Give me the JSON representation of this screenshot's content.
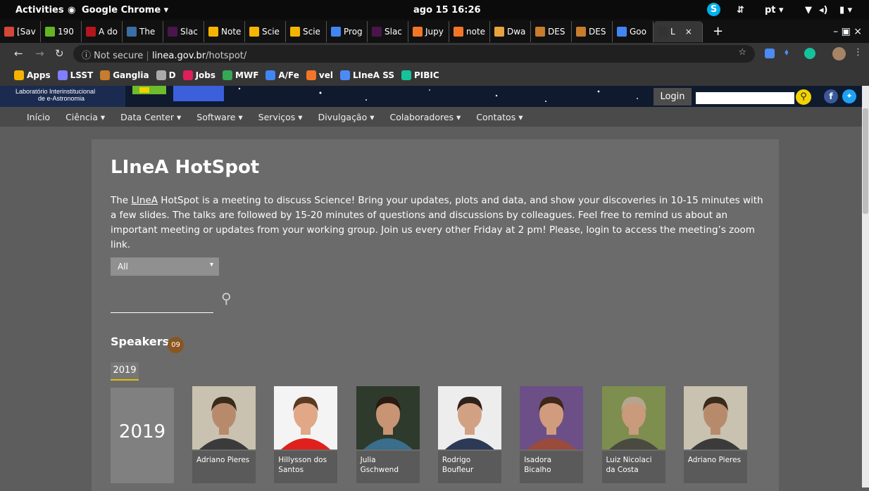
{
  "os_bar": {
    "activities": "Activities",
    "app": "Google Chrome ▾",
    "datetime": "ago 15 16:26",
    "lang": "pt ▾"
  },
  "tabs": [
    {
      "label": "[Sav",
      "color": "#d44638"
    },
    {
      "label": "190",
      "color": "#63b521"
    },
    {
      "label": "A do",
      "color": "#b3161c"
    },
    {
      "label": "The",
      "color": "#3a6ea5"
    },
    {
      "label": "Slac",
      "color": "#4a154b"
    },
    {
      "label": "Note",
      "color": "#f4b400"
    },
    {
      "label": "Scie",
      "color": "#f4b400"
    },
    {
      "label": "Scie",
      "color": "#f4b400"
    },
    {
      "label": "Prog",
      "color": "#4285f4"
    },
    {
      "label": "Slac",
      "color": "#4a154b"
    },
    {
      "label": "Jupy",
      "color": "#f37626"
    },
    {
      "label": "note",
      "color": "#f37626"
    },
    {
      "label": "Dwa",
      "color": "#e8a33d"
    },
    {
      "label": "DES",
      "color": "#c77c2e"
    },
    {
      "label": "DES",
      "color": "#c77c2e"
    },
    {
      "label": "Goo",
      "color": "#4285f4"
    },
    {
      "label": "L",
      "color": "#333333"
    }
  ],
  "address": {
    "security": "Not secure",
    "host": "linea.gov.br",
    "path": "/hotspot/"
  },
  "bookmarks": [
    "Apps",
    "LSST",
    "Ganglia",
    "D",
    "Jobs",
    "MWF",
    "A/Fe",
    "vel",
    "LIneA SS",
    "PIBIC"
  ],
  "site": {
    "logo_line1": "Laboratório Interinstitucional",
    "logo_line2": "de e-Astronomia",
    "login": "Login"
  },
  "nav": [
    "Início",
    "Ciência ▾",
    "Data Center ▾",
    "Software ▾",
    "Serviços ▾",
    "Divulgação ▾",
    "Colaboradores ▾",
    "Contatos ▾"
  ],
  "page": {
    "title": "LIneA HotSpot",
    "intro_prefix": "The ",
    "intro_link": "LIneA",
    "intro_rest": " HotSpot is a meeting to discuss Science! Bring your updates, plots and data, and show your discoveries in 10-15 minutes with a few slides. The talks are followed by 15-20 minutes of questions and discussions by colleagues. Feel free to remind us about an important meeting or updates from your working group. Join us every other Friday at 2 pm!  Please, login to access the meeting’s zoom link.",
    "filter_value": "All",
    "speakers_label": "Speakers",
    "speakers_count": "09",
    "year_tab": "2019",
    "year_big": "2019"
  },
  "speakers": [
    {
      "name": "Adriano Pieres",
      "bg": "#c9c2b0",
      "shirt": "#3b3b3b",
      "skin": "#b88a6c",
      "hair": "#3a2a1c"
    },
    {
      "name": "Hillysson dos Santos",
      "bg": "#f4f4f4",
      "shirt": "#e0201c",
      "skin": "#e0a887",
      "hair": "#5a3a22"
    },
    {
      "name": "Julia Gschwend",
      "bg": "#2e3a2c",
      "shirt": "#3a6e8a",
      "skin": "#c99474",
      "hair": "#2a1a12"
    },
    {
      "name": "Rodrigo Boufleur",
      "bg": "#ededed",
      "shirt": "#2c3a55",
      "skin": "#d2a184",
      "hair": "#2e2118"
    },
    {
      "name": "Isadora Bicalho",
      "bg": "#6d4f88",
      "shirt": "#9a4b3b",
      "skin": "#d09c7d",
      "hair": "#3e2716"
    },
    {
      "name": "Luiz Nicolaci da Costa",
      "bg": "#7d8e4e",
      "shirt": "#4a4a40",
      "skin": "#c99a7c",
      "hair": "#b5a58e"
    },
    {
      "name": "Adriano Pieres",
      "bg": "#c9c2b0",
      "shirt": "#3b3b3b",
      "skin": "#b88a6c",
      "hair": "#3a2a1c"
    }
  ]
}
